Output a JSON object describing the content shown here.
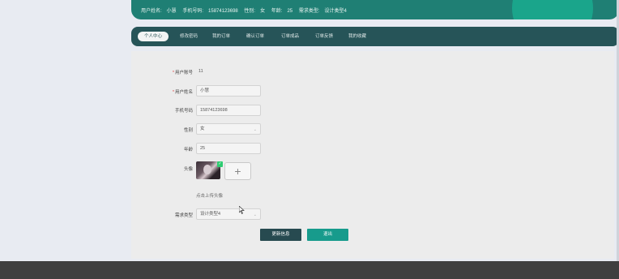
{
  "header": {
    "username_label": "用户姓名:",
    "username": "小慧",
    "phone_label": "手机号码:",
    "phone": "15874123698",
    "gender_label": "性别:",
    "gender": "女",
    "age_label": "年龄:",
    "age": "25",
    "need_type_label": "需求类型:",
    "need_type": "设计类型4"
  },
  "nav": {
    "items": [
      {
        "label": "个人中心"
      },
      {
        "label": "修改密码"
      },
      {
        "label": "我的订单"
      },
      {
        "label": "确认订单"
      },
      {
        "label": "订单成品"
      },
      {
        "label": "订单反馈"
      },
      {
        "label": "我的收藏"
      }
    ]
  },
  "form": {
    "account_label": "用户账号",
    "account_value": "11",
    "name_label": "用户姓名",
    "name_value": "小慧",
    "phone_label": "手机号码",
    "phone_value": "15874123698",
    "gender_label": "性别",
    "gender_value": "女",
    "age_label": "年龄",
    "age_value": "25",
    "avatar_label": "头像",
    "avatar_hint": "点击上传头像",
    "upload_symbol": "+",
    "need_type_label": "需求类型",
    "need_type_value": "设计类型4",
    "required_mark": "*",
    "chevron": "⌄",
    "check": "✓"
  },
  "buttons": {
    "update_label": "更新信息",
    "logout_label": "退出"
  },
  "colors": {
    "banner": "#1f7f74",
    "nav": "#265458",
    "update_button": "#274a50",
    "logout_button": "#179b8c"
  }
}
